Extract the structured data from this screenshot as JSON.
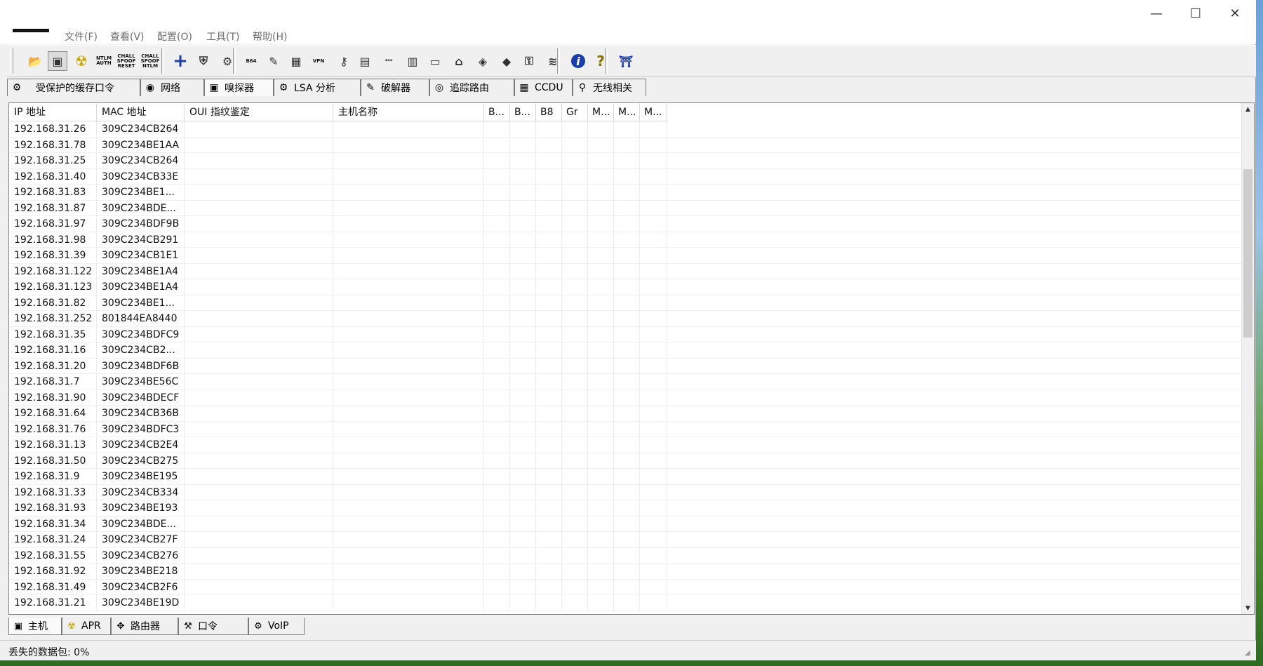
{
  "window": {
    "controls": {
      "minimize": "—",
      "maximize": "☐",
      "close": "✕"
    }
  },
  "menu": {
    "items": [
      "文件(F)",
      "查看(V)",
      "配置(O)",
      "工具(T)",
      "帮助(H)"
    ]
  },
  "toolbar": {
    "buttons": [
      {
        "icon": "open-folder-icon",
        "glyph": "📂"
      },
      {
        "icon": "sniffer-nic-icon",
        "glyph": "▣"
      },
      {
        "icon": "apr-radiation-icon",
        "glyph": "☢"
      },
      {
        "icon": "ntlm-auth-icon",
        "text": "NTLM AUTH"
      },
      {
        "icon": "chall-spoof-reset-icon",
        "text": "CHALL SPOOF RESET"
      },
      {
        "icon": "chall-spoof-ntlm-icon",
        "text": "CHALL SPOOF NTLM"
      },
      {
        "icon": "add-plus-icon",
        "glyph": "+"
      },
      {
        "icon": "shield-certificate-icon",
        "glyph": "⛨"
      },
      {
        "icon": "decoder-icon",
        "glyph": "⚙"
      },
      {
        "icon": "base64-icon",
        "text": "B64"
      },
      {
        "icon": "hash-calculator-icon",
        "glyph": "✎"
      },
      {
        "icon": "lsa-secrets-icon",
        "glyph": "▦"
      },
      {
        "icon": "vpn-icon",
        "text": "VPN"
      },
      {
        "icon": "wireless-key-icon",
        "glyph": "⚷"
      },
      {
        "icon": "mac-address-scanner-icon",
        "glyph": "▤"
      },
      {
        "icon": "password-asterisks-icon",
        "text": "***"
      },
      {
        "icon": "network-card-icon",
        "glyph": "▥"
      },
      {
        "icon": "monitor-icon",
        "glyph": "▭"
      },
      {
        "icon": "cisco-config-icon",
        "glyph": "⌂"
      },
      {
        "icon": "rdp-icon",
        "glyph": "◈"
      },
      {
        "icon": "box-icon",
        "glyph": "◆"
      },
      {
        "icon": "key-lock-icon",
        "glyph": "⚿"
      },
      {
        "icon": "wireless-signal-icon",
        "glyph": "≋"
      },
      {
        "icon": "info-icon",
        "glyph": "i"
      },
      {
        "icon": "help-question-icon",
        "glyph": "?"
      },
      {
        "icon": "exit-door-icon",
        "glyph": "⛩"
      }
    ]
  },
  "top_tabs": [
    {
      "label": "受保护的缓存口令",
      "icon": "protected-storage-icon",
      "glyph": "⚙"
    },
    {
      "label": "网络",
      "icon": "network-globe-icon",
      "glyph": "◉"
    },
    {
      "label": "嗅探器",
      "icon": "sniffer-icon",
      "glyph": "▣",
      "active": true
    },
    {
      "label": "LSA 分析",
      "icon": "lsa-icon",
      "glyph": "⚙"
    },
    {
      "label": "破解器",
      "icon": "cracker-icon",
      "glyph": "✎"
    },
    {
      "label": "追踪路由",
      "icon": "traceroute-icon",
      "glyph": "◎"
    },
    {
      "label": "CCDU",
      "icon": "ccdu-icon",
      "glyph": "▦"
    },
    {
      "label": "无线相关",
      "icon": "wireless-icon",
      "glyph": "⚲"
    }
  ],
  "table": {
    "columns": [
      "IP 地址",
      "MAC 地址",
      "OUI 指纹鉴定",
      "主机名称",
      "B...",
      "B...",
      "B8",
      "Gr",
      "M...",
      "M...",
      "M..."
    ],
    "rows": [
      [
        "192.168.31.26",
        "309C234CB264"
      ],
      [
        "192.168.31.78",
        "309C234BE1AA"
      ],
      [
        "192.168.31.25",
        "309C234CB264"
      ],
      [
        "192.168.31.40",
        "309C234CB33E"
      ],
      [
        "192.168.31.83",
        "309C234BE1..."
      ],
      [
        "192.168.31.87",
        "309C234BDE..."
      ],
      [
        "192.168.31.97",
        "309C234BDF9B"
      ],
      [
        "192.168.31.98",
        "309C234CB291"
      ],
      [
        "192.168.31.39",
        "309C234CB1E1"
      ],
      [
        "192.168.31.122",
        "309C234BE1A4"
      ],
      [
        "192.168.31.123",
        "309C234BE1A4"
      ],
      [
        "192.168.31.82",
        "309C234BE1..."
      ],
      [
        "192.168.31.252",
        "801844EA8440"
      ],
      [
        "192.168.31.35",
        "309C234BDFC9"
      ],
      [
        "192.168.31.16",
        "309C234CB2..."
      ],
      [
        "192.168.31.20",
        "309C234BDF6B"
      ],
      [
        "192.168.31.7",
        "309C234BE56C"
      ],
      [
        "192.168.31.90",
        "309C234BDECF"
      ],
      [
        "192.168.31.64",
        "309C234CB36B"
      ],
      [
        "192.168.31.76",
        "309C234BDFC3"
      ],
      [
        "192.168.31.13",
        "309C234CB2E4"
      ],
      [
        "192.168.31.50",
        "309C234CB275"
      ],
      [
        "192.168.31.9",
        "309C234BE195"
      ],
      [
        "192.168.31.33",
        "309C234CB334"
      ],
      [
        "192.168.31.93",
        "309C234BE193"
      ],
      [
        "192.168.31.34",
        "309C234BDE..."
      ],
      [
        "192.168.31.24",
        "309C234CB27F"
      ],
      [
        "192.168.31.55",
        "309C234CB276"
      ],
      [
        "192.168.31.92",
        "309C234BE218"
      ],
      [
        "192.168.31.49",
        "309C234CB2F6"
      ],
      [
        "192.168.31.21",
        "309C234BE19D"
      ]
    ]
  },
  "bottom_tabs": [
    {
      "label": "主机",
      "icon": "host-computer-icon",
      "glyph": "▣",
      "active": true
    },
    {
      "label": "APR",
      "icon": "apr-icon",
      "glyph": "☢"
    },
    {
      "label": "路由器",
      "icon": "router-icon",
      "glyph": "✥"
    },
    {
      "label": "口令",
      "icon": "password-icon",
      "glyph": "⚒"
    },
    {
      "label": "VoIP",
      "icon": "voip-icon",
      "glyph": "⚙"
    }
  ],
  "status": {
    "lost_packets": "丢失的数据包:  0%"
  }
}
